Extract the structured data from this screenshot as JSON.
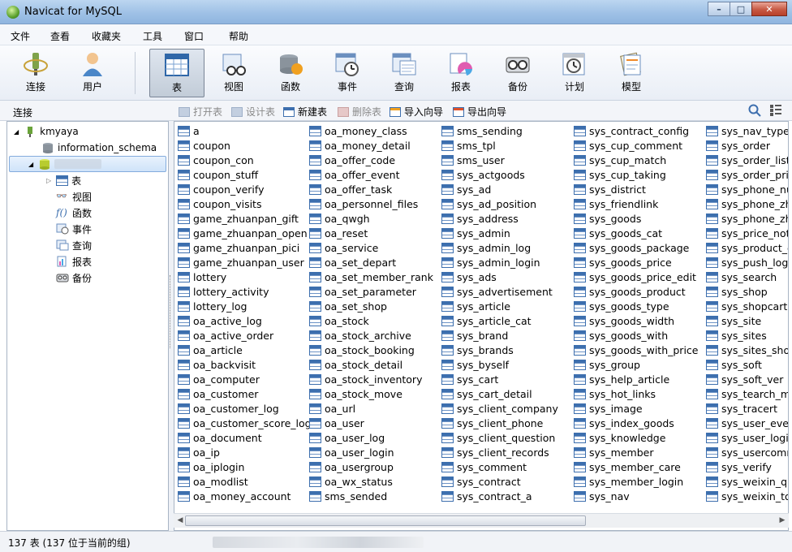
{
  "window": {
    "title": "Navicat for MySQL",
    "min": "–",
    "max": "□",
    "close": "✕"
  },
  "menu": [
    "文件",
    "查看",
    "收藏夹",
    "工具",
    "窗口",
    "帮助"
  ],
  "toolbar": {
    "buttons": [
      {
        "label": "连接",
        "icon": "connection-plug-icon"
      },
      {
        "label": "用户",
        "icon": "user-icon"
      },
      {
        "label": "表",
        "icon": "table-icon",
        "active": true
      },
      {
        "label": "视图",
        "icon": "view-glasses-icon"
      },
      {
        "label": "函数",
        "icon": "function-icon"
      },
      {
        "label": "事件",
        "icon": "event-clock-icon"
      },
      {
        "label": "查询",
        "icon": "query-icon"
      },
      {
        "label": "报表",
        "icon": "report-icon"
      },
      {
        "label": "备份",
        "icon": "backup-icon"
      },
      {
        "label": "计划",
        "icon": "schedule-icon"
      },
      {
        "label": "模型",
        "icon": "model-icon"
      }
    ]
  },
  "object_bar": {
    "section_label": "连接",
    "buttons": [
      {
        "label": "打开表",
        "enabled": false
      },
      {
        "label": "设计表",
        "enabled": false
      },
      {
        "label": "新建表",
        "enabled": true
      },
      {
        "label": "删除表",
        "enabled": false
      },
      {
        "label": "导入向导",
        "enabled": true
      },
      {
        "label": "导出向导",
        "enabled": true
      }
    ]
  },
  "tree": {
    "connection": "kmyaya",
    "databases": [
      "information_schema"
    ],
    "children": [
      "表",
      "视图",
      "函数",
      "事件",
      "查询",
      "报表",
      "备份"
    ]
  },
  "tables": [
    [
      "a",
      "coupon",
      "coupon_con",
      "coupon_stuff",
      "coupon_verify",
      "coupon_visits",
      "game_zhuanpan_gift",
      "game_zhuanpan_open",
      "game_zhuanpan_pici",
      "game_zhuanpan_user",
      "lottery",
      "lottery_activity",
      "lottery_log",
      "oa_active_log",
      "oa_active_order",
      "oa_article",
      "oa_backvisit",
      "oa_computer",
      "oa_customer",
      "oa_customer_log",
      "oa_customer_score_log",
      "oa_document",
      "oa_ip",
      "oa_iplogin",
      "oa_modlist",
      "oa_money_account"
    ],
    [
      "oa_money_class",
      "oa_money_detail",
      "oa_offer_code",
      "oa_offer_event",
      "oa_offer_task",
      "oa_personnel_files",
      "oa_qwgh",
      "oa_reset",
      "oa_service",
      "oa_set_depart",
      "oa_set_member_rank",
      "oa_set_parameter",
      "oa_set_shop",
      "oa_stock",
      "oa_stock_archive",
      "oa_stock_booking",
      "oa_stock_detail",
      "oa_stock_inventory",
      "oa_stock_move",
      "oa_url",
      "oa_user",
      "oa_user_log",
      "oa_user_login",
      "oa_usergroup",
      "oa_wx_status",
      "sms_sended"
    ],
    [
      "sms_sending",
      "sms_tpl",
      "sms_user",
      "sys_actgoods",
      "sys_ad",
      "sys_ad_position",
      "sys_address",
      "sys_admin",
      "sys_admin_log",
      "sys_admin_login",
      "sys_ads",
      "sys_advertisement",
      "sys_article",
      "sys_article_cat",
      "sys_brand",
      "sys_brands",
      "sys_byself",
      "sys_cart",
      "sys_cart_detail",
      "sys_client_company",
      "sys_client_phone",
      "sys_client_question",
      "sys_client_records",
      "sys_comment",
      "sys_contract",
      "sys_contract_a"
    ],
    [
      "sys_contract_config",
      "sys_cup_comment",
      "sys_cup_match",
      "sys_cup_taking",
      "sys_district",
      "sys_friendlink",
      "sys_goods",
      "sys_goods_cat",
      "sys_goods_package",
      "sys_goods_price",
      "sys_goods_price_edit",
      "sys_goods_product",
      "sys_goods_type",
      "sys_goods_width",
      "sys_goods_with",
      "sys_goods_with_price",
      "sys_group",
      "sys_help_article",
      "sys_hot_links",
      "sys_image",
      "sys_index_goods",
      "sys_knowledge",
      "sys_member",
      "sys_member_care",
      "sys_member_login",
      "sys_nav"
    ],
    [
      "sys_nav_type",
      "sys_order",
      "sys_order_list",
      "sys_order_pric",
      "sys_phone_nu",
      "sys_phone_zhu",
      "sys_phone_zhu",
      "sys_price_noti",
      "sys_product_c",
      "sys_push_log",
      "sys_search",
      "sys_shop",
      "sys_shopcart",
      "sys_site",
      "sys_sites",
      "sys_sites_shop",
      "sys_soft",
      "sys_soft_ver",
      "sys_tearch_ms",
      "sys_tracert",
      "sys_user_every",
      "sys_user_login",
      "sys_usercomm",
      "sys_verify",
      "sys_weixin_qro",
      "sys_weixin_tok"
    ]
  ],
  "status": {
    "text": "137 表 (137 位于当前的组)"
  }
}
